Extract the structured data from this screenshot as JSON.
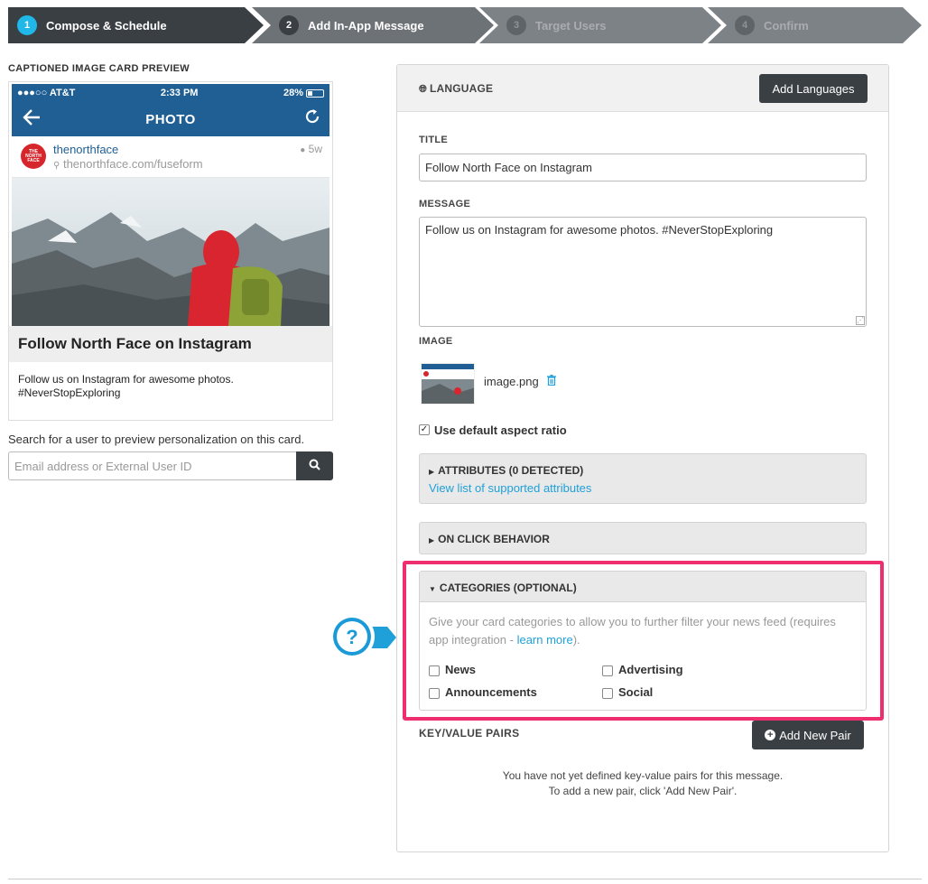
{
  "wizard": {
    "steps": [
      {
        "number": "1",
        "label": "Compose & Schedule"
      },
      {
        "number": "2",
        "label": "Add In-App Message"
      },
      {
        "number": "3",
        "label": "Target Users"
      },
      {
        "number": "4",
        "label": "Confirm"
      }
    ]
  },
  "preview": {
    "heading": "CAPTIONED IMAGE CARD PREVIEW",
    "phone": {
      "carrier": "●●●○○ AT&T",
      "time": "2:33 PM",
      "battery": "28%",
      "nav_title": "PHOTO"
    },
    "instagram": {
      "avatar_text": "THE NORTH FACE",
      "username": "thenorthface",
      "location": "thenorthface.com/fuseform",
      "age": "5w"
    },
    "card_title": "Follow North Face on Instagram",
    "card_message": "Follow us on Instagram for awesome photos. #NeverStopExploring",
    "search_caption": "Search for a user to preview personalization on this card.",
    "search_placeholder": "Email address or External User ID"
  },
  "form": {
    "language_label": "LANGUAGE",
    "add_languages_label": "Add Languages",
    "title_label": "TITLE",
    "title_value": "Follow North Face on Instagram",
    "message_label": "MESSAGE",
    "message_value": "Follow us on Instagram for awesome photos. #NeverStopExploring",
    "image_label": "IMAGE",
    "image_name": "image.png",
    "aspect_label": "Use default aspect ratio",
    "aspect_checked": true,
    "attributes_title": "ATTRIBUTES (0 DETECTED)",
    "attributes_link": "View list of supported attributes",
    "on_click_title": "ON CLICK BEHAVIOR",
    "categories": {
      "title": "CATEGORIES (OPTIONAL)",
      "description": "Give your card categories to allow you to further filter your news feed (requires app integration - ",
      "learn_more": "learn more",
      "description_end": ").",
      "options": [
        "News",
        "Advertising",
        "Announcements",
        "Social"
      ]
    },
    "kv_label": "KEY/VALUE PAIRS",
    "add_pair_label": "Add New Pair",
    "kv_empty_line1": "You have not yet defined key-value pairs for this message.",
    "kv_empty_line2": "To add a new pair, click 'Add New Pair'."
  },
  "colors": {
    "accent": "#20b8e8",
    "dark_button": "#3a3f44",
    "link": "#20a0d8",
    "highlight": "#ef2e6f",
    "phone_bar": "#1f5f94"
  }
}
